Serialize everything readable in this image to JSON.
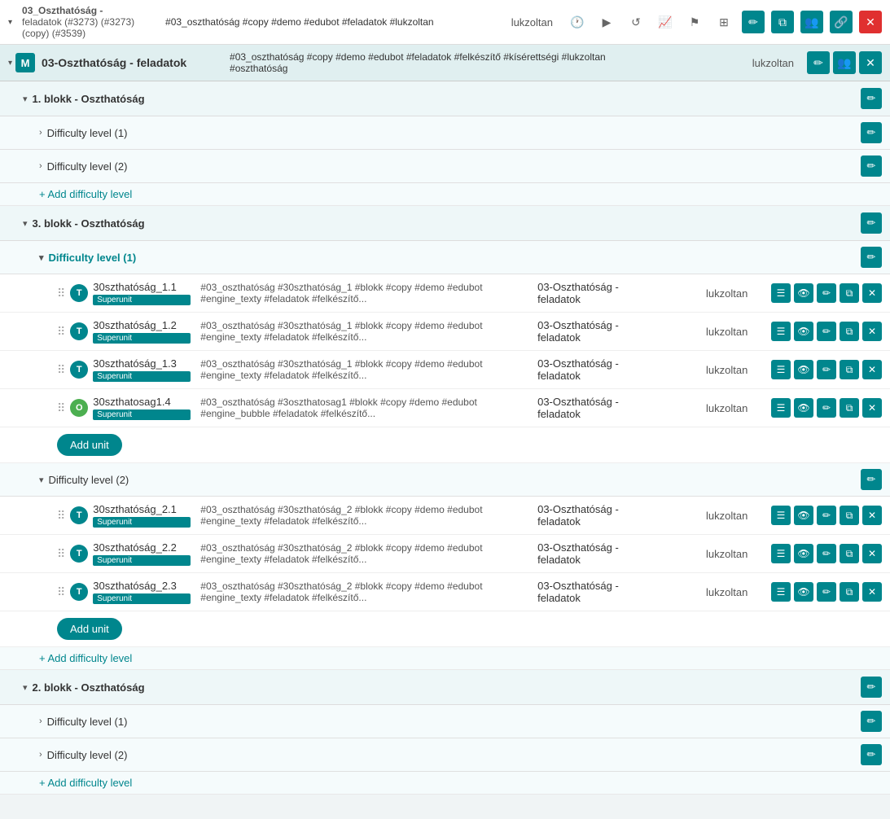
{
  "header": {
    "title_line1": "03_Oszthatóság -",
    "title_line2": "feladatok (#3273) (#3273)",
    "title_line3": "(copy) (#3539)",
    "tags": "#03_oszthatóság #copy #demo #edubot #feladatok #lukzoltan",
    "user": "lukzoltan",
    "icons": [
      "history",
      "play",
      "reset",
      "chart",
      "flag",
      "screen",
      "edit",
      "share",
      "people",
      "link",
      "red-x"
    ]
  },
  "section": {
    "icon": "M",
    "name": "03-Oszthatóság - feladatok",
    "tags": "#03_oszthatóság #copy #demo #edubot #feladatok #felkészítő #kísérettségi #lukzoltan #oszthatóság",
    "user": "lukzoltan"
  },
  "blocks": [
    {
      "name": "1. blokk - Oszthatóság",
      "expanded": true,
      "difficulties": [
        {
          "name": "Difficulty level (1)",
          "expanded": false,
          "active": false,
          "units": []
        },
        {
          "name": "Difficulty level (2)",
          "expanded": false,
          "active": false,
          "units": []
        }
      ],
      "add_difficulty_label": "+ Add difficulty level"
    },
    {
      "name": "3. blokk - Oszthatóság",
      "expanded": true,
      "difficulties": [
        {
          "name": "Difficulty level (1)",
          "expanded": true,
          "active": true,
          "units": [
            {
              "type": "T",
              "type_color": "teal",
              "name": "30szthatóság_1.1",
              "badge": "Superunit",
              "tags": "#03_oszthatóság #30szthatóság_1 #blokk #copy #demo #edubot #engine_texty #feladatok #felkészítő...",
              "collection": "03-Oszthatóság - feladatok",
              "user": "lukzoltan"
            },
            {
              "type": "T",
              "type_color": "teal",
              "name": "30szthatóság_1.2",
              "badge": "Superunit",
              "tags": "#03_oszthatóság #30szthatóság_1 #blokk #copy #demo #edubot #engine_texty #feladatok #felkészítő...",
              "collection": "03-Oszthatóság - feladatok",
              "user": "lukzoltan"
            },
            {
              "type": "T",
              "type_color": "teal",
              "name": "30szthatóság_1.3",
              "badge": "Superunit",
              "tags": "#03_oszthatóság #30szthatóság_1 #blokk #copy #demo #edubot #engine_texty #feladatok #felkészítő...",
              "collection": "03-Oszthatóság - feladatok",
              "user": "lukzoltan"
            },
            {
              "type": "O",
              "type_color": "green",
              "name": "30szthatosag1.4",
              "badge": "Superunit",
              "tags": "#03_oszthatóság #3oszthatosag1 #blokk #copy #demo #edubot #engine_bubble #feladatok #felkészítő...",
              "collection": "03-Oszthatóság - feladatok",
              "user": "lukzoltan"
            }
          ]
        },
        {
          "name": "Difficulty level (2)",
          "expanded": true,
          "active": false,
          "units": [
            {
              "type": "T",
              "type_color": "teal",
              "name": "30szthatóság_2.1",
              "badge": "Superunit",
              "tags": "#03_oszthatóság #30szthatóság_2 #blokk #copy #demo #edubot #engine_texty #feladatok #felkészítő...",
              "collection": "03-Oszthatóság - feladatok",
              "user": "lukzoltan"
            },
            {
              "type": "T",
              "type_color": "teal",
              "name": "30szthatóság_2.2",
              "badge": "Superunit",
              "tags": "#03_oszthatóság #30szthatóság_2 #blokk #copy #demo #edubot #engine_texty #feladatok #felkészítő...",
              "collection": "03-Oszthatóság - feladatok",
              "user": "lukzoltan"
            },
            {
              "type": "T",
              "type_color": "teal",
              "name": "30szthatóság_2.3",
              "badge": "Superunit",
              "tags": "#03_oszthatóság #30szthatóság_2 #blokk #copy #demo #edubot #engine_texty #feladatok #felkészítő...",
              "collection": "03-Oszthatóság - feladatok",
              "user": "lukzoltan"
            }
          ]
        }
      ],
      "add_difficulty_label": "+ Add difficulty level"
    },
    {
      "name": "2. blokk - Oszthatóság",
      "expanded": true,
      "difficulties": [
        {
          "name": "Difficulty level (1)",
          "expanded": false,
          "active": false,
          "units": []
        },
        {
          "name": "Difficulty level (2)",
          "expanded": false,
          "active": false,
          "units": []
        }
      ],
      "add_difficulty_label": "+ Add difficulty level"
    }
  ],
  "add_unit_label": "Add unit",
  "icons": {
    "pencil": "✏",
    "eye": "👁",
    "copy": "⧉",
    "trash": "✕",
    "chevron_right": "›",
    "chevron_down": "⌄",
    "drag": "⠿"
  }
}
